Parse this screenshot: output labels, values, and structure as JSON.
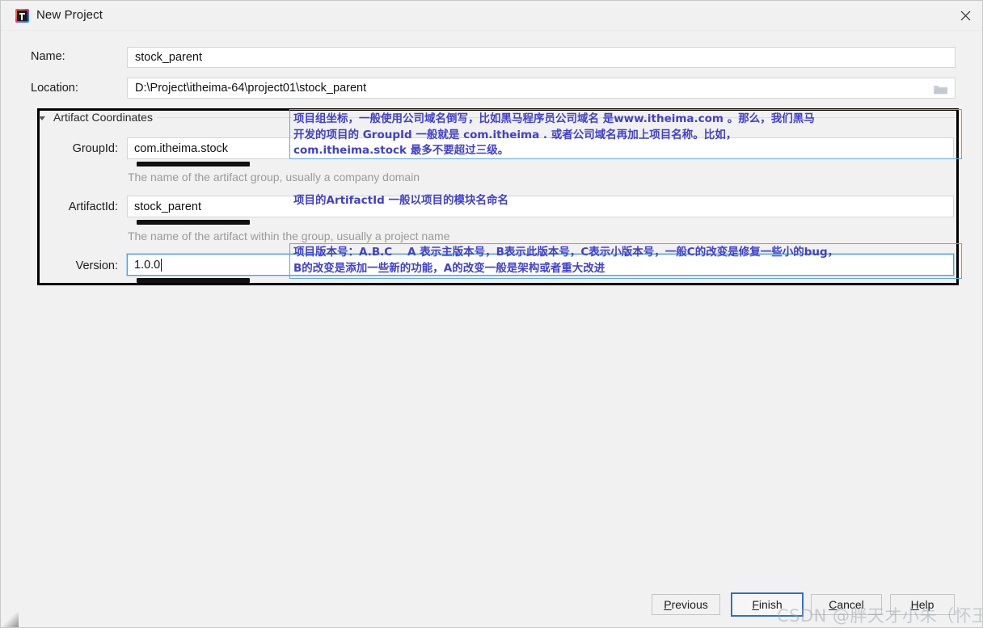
{
  "window": {
    "title": "New Project",
    "app_icon": "intellij-idea-icon",
    "close_icon": "close-icon"
  },
  "form": {
    "name": {
      "label": "Name:",
      "value": "stock_parent",
      "placeholder": ""
    },
    "location": {
      "label": "Location:",
      "value": "D:\\Project\\itheima-64\\project01\\stock_parent",
      "placeholder": "",
      "browse_icon": "folder-icon"
    }
  },
  "artifact_group": {
    "title": "Artifact Coordinates",
    "collapse_icon": "chevron-down-icon",
    "group_id": {
      "label": "GroupId:",
      "value": "com.itheima.stock",
      "hint": "The name of the artifact group, usually a company domain"
    },
    "artifact_id": {
      "label": "ArtifactId:",
      "value": "stock_parent",
      "hint": "The name of the artifact within the group, usually a project name"
    },
    "version": {
      "label": "Version:",
      "value": "1.0.0",
      "hint": ""
    }
  },
  "annotations": {
    "group_id_note": "项目组坐标，一般使用公司域名倒写，比如黑马程序员公司域名 是www.itheima.com 。那么，我们黑马\n开发的项目的 GroupId 一般就是 com.itheima . 或者公司域名再加上项目名称。比如，\ncom.itheima.stock 最多不要超过三级。",
    "artifact_id_note": "项目的ArtifactId 一般以项目的模块名命名",
    "version_note": "项目版本号：A.B.C    A 表示主版本号，B表示此版本号，C表示小版本号，一般C的改变是修复一些小的bug，\nB的改变是添加一些新的功能，A的改变一般是架构或者重大改进",
    "color": "#4040d0",
    "box_color": "#5ea8e8"
  },
  "buttons": {
    "previous": {
      "prefix": "",
      "mnemonic": "P",
      "suffix": "revious"
    },
    "finish": {
      "prefix": "",
      "mnemonic": "F",
      "suffix": "inish"
    },
    "cancel": {
      "prefix": "",
      "mnemonic": "C",
      "suffix": "ancel"
    },
    "help": {
      "prefix": "",
      "mnemonic": "H",
      "suffix": "elp"
    }
  },
  "watermark": {
    "text": "CSDN @胖天才小朱（怀玉）"
  }
}
